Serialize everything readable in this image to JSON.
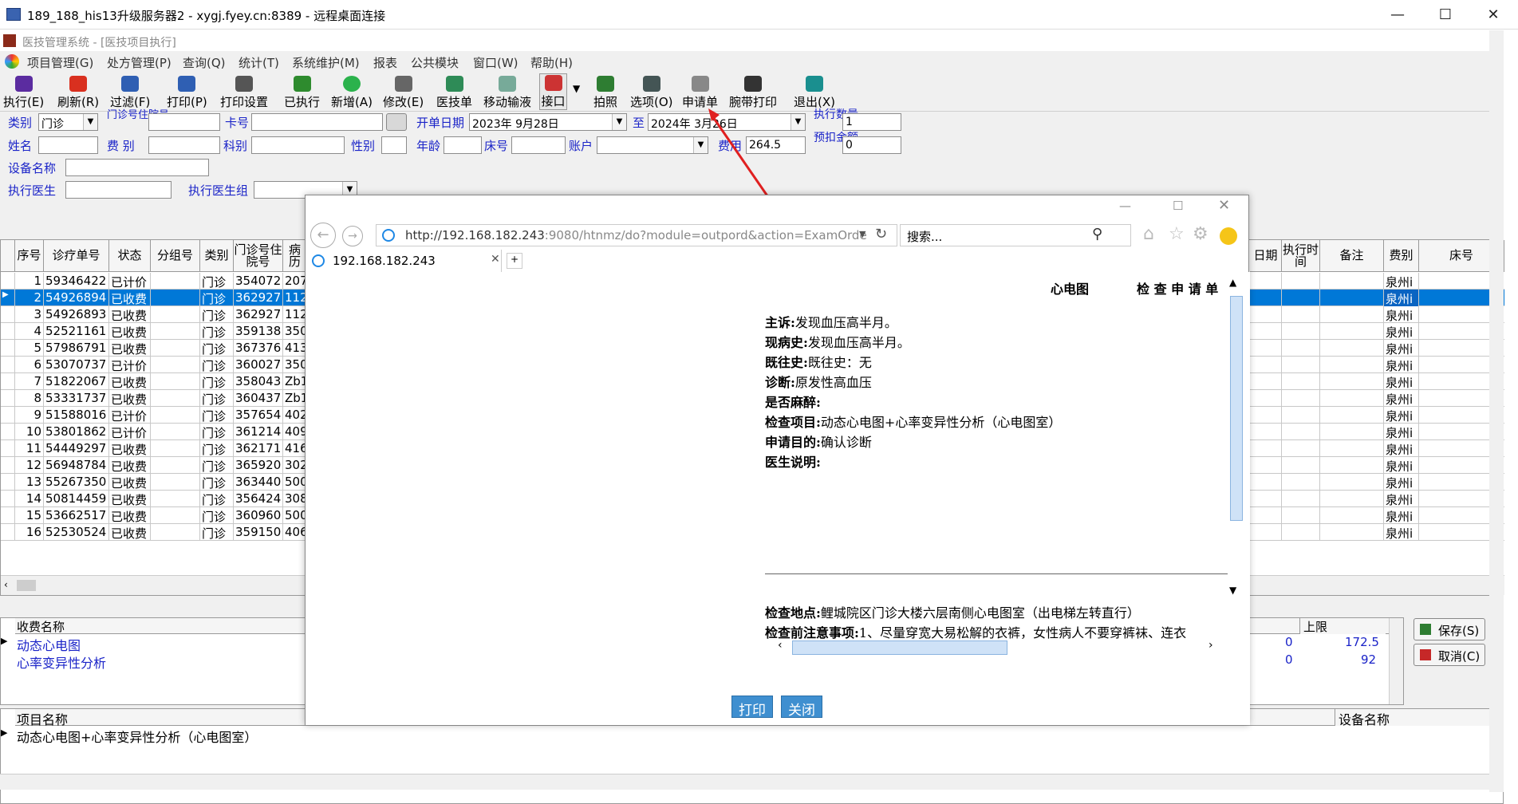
{
  "rdp": {
    "title": "189_188_his13升级服务器2 - xygj.fyey.cn:8389 - 远程桌面连接",
    "min": "—",
    "max": "☐",
    "close": "✕"
  },
  "app": {
    "title": "医技管理系统 - [医技项目执行]"
  },
  "menu": [
    "项目管理(G)",
    "处方管理(P)",
    "查询(Q)",
    "统计(T)",
    "系统维护(M)",
    "报表",
    "公共模块",
    "窗口(W)",
    "帮助(H)"
  ],
  "toolbar": [
    "执行(E)",
    "刷新(R)",
    "过滤(F)",
    "打印(P)",
    "打印设置",
    "已执行",
    "新增(A)",
    "修改(E)",
    "医技单",
    "移动输液",
    "接口",
    "拍照",
    "选项(O)",
    "申请单",
    "腕带打印",
    "退出(X)"
  ],
  "form": {
    "category_label": "类别",
    "category": "门诊",
    "clinic_label": "门诊号住院号",
    "card_label": "卡号",
    "start_label": "开单日期",
    "start": "2023年 9月28日",
    "to_label": "至",
    "end": "2024年 3月26日",
    "exec_qty_label": "执行数量",
    "exec_qty": "1",
    "name_label": "姓名",
    "fee_type_label": "费  别",
    "dept_label": "科别",
    "sex_label": "性别",
    "age_label": "年龄",
    "bed_label": "床号",
    "account_label": "账户",
    "cost_label": "费用",
    "cost": "264.5",
    "prepay_label": "预扣金额",
    "prepay": "0",
    "device_label": "设备名称",
    "doctor_label": "执行医生",
    "doctor_group_label": "执行医生组"
  },
  "grid": {
    "headers": [
      "序号",
      "诊疗单号",
      "状态",
      "分组号",
      "类别",
      "门诊号住院号",
      "病历"
    ],
    "right_headers": [
      "日期",
      "执行时间",
      "备注",
      "费别",
      "床号"
    ],
    "rows": [
      [
        "1",
        "59346422",
        "已计价",
        "",
        "门诊",
        "354072",
        "207",
        "泉州i"
      ],
      [
        "2",
        "54926894",
        "已收费",
        "",
        "门诊",
        "362927",
        "112",
        "泉州i"
      ],
      [
        "3",
        "54926893",
        "已收费",
        "",
        "门诊",
        "362927",
        "112",
        "泉州i"
      ],
      [
        "4",
        "52521161",
        "已收费",
        "",
        "门诊",
        "359138",
        "350",
        "泉州i"
      ],
      [
        "5",
        "57986791",
        "已收费",
        "",
        "门诊",
        "367376",
        "413",
        "泉州i"
      ],
      [
        "6",
        "53070737",
        "已计价",
        "",
        "门诊",
        "360027",
        "350",
        "泉州i"
      ],
      [
        "7",
        "51822067",
        "已收费",
        "",
        "门诊",
        "358043",
        "Zb1",
        "泉州i"
      ],
      [
        "8",
        "53331737",
        "已收费",
        "",
        "门诊",
        "360437",
        "Zb1",
        "泉州i"
      ],
      [
        "9",
        "51588016",
        "已计价",
        "",
        "门诊",
        "357654",
        "402",
        "泉州i"
      ],
      [
        "10",
        "53801862",
        "已计价",
        "",
        "门诊",
        "361214",
        "409",
        "泉州i"
      ],
      [
        "11",
        "54449297",
        "已收费",
        "",
        "门诊",
        "362171",
        "416",
        "泉州i"
      ],
      [
        "12",
        "56948784",
        "已收费",
        "",
        "门诊",
        "365920",
        "302",
        "泉州i"
      ],
      [
        "13",
        "55267350",
        "已收费",
        "",
        "门诊",
        "363440",
        "500",
        "泉州i"
      ],
      [
        "14",
        "50814459",
        "已收费",
        "",
        "门诊",
        "356424",
        "308",
        "泉州i"
      ],
      [
        "15",
        "53662517",
        "已收费",
        "",
        "门诊",
        "360960",
        "500",
        "泉州i"
      ],
      [
        "16",
        "52530524",
        "已收费",
        "",
        "门诊",
        "359150",
        "406",
        "泉州i"
      ]
    ]
  },
  "fee": {
    "header": "收费名称",
    "limit_header": "上限",
    "rows": [
      {
        "name": "动态心电图",
        "v1": "0",
        "v2": "172.5"
      },
      {
        "name": "心率变异性分析",
        "v1": "0",
        "v2": "92"
      }
    ]
  },
  "buttons": {
    "save": "保存(S)",
    "cancel": "取消(C)"
  },
  "items": {
    "header": "项目名称",
    "device_header": "设备名称",
    "row": "动态心电图+心率变异性分析（心电图室）"
  },
  "browser": {
    "url_host": "http://192.168.182.243",
    "url_rest": ":9080/htnmz/do?module=outpord&action=ExamOrde",
    "search": "搜索...",
    "tab": "192.168.182.243"
  },
  "doc": {
    "head1": "心电图",
    "head2": "检 查 申 请 单",
    "lines": [
      {
        "k": "主诉:",
        "v": "发现血压高半月。"
      },
      {
        "k": "现病史:",
        "v": "发现血压高半月。"
      },
      {
        "k": "既往史:",
        "v": "既往史：无"
      },
      {
        "k": "诊断:",
        "v": "原发性高血压"
      },
      {
        "k": "是否麻醉:",
        "v": ""
      },
      {
        "k": "检查项目:",
        "v": "动态心电图+心率变异性分析（心电图室）"
      },
      {
        "k": "申请目的:",
        "v": "确认诊断"
      },
      {
        "k": "医生说明:",
        "v": ""
      }
    ],
    "location_k": "检查地点:",
    "location_v": "鲤城院区门诊大楼六层南侧心电图室（出电梯左转直行）",
    "notes_k": "检查前注意事项:",
    "notes_v": "1、尽量穿宽大易松解的衣裤，女性病人不要穿裤袜、连衣",
    "print": "打印",
    "close": "关闭"
  }
}
